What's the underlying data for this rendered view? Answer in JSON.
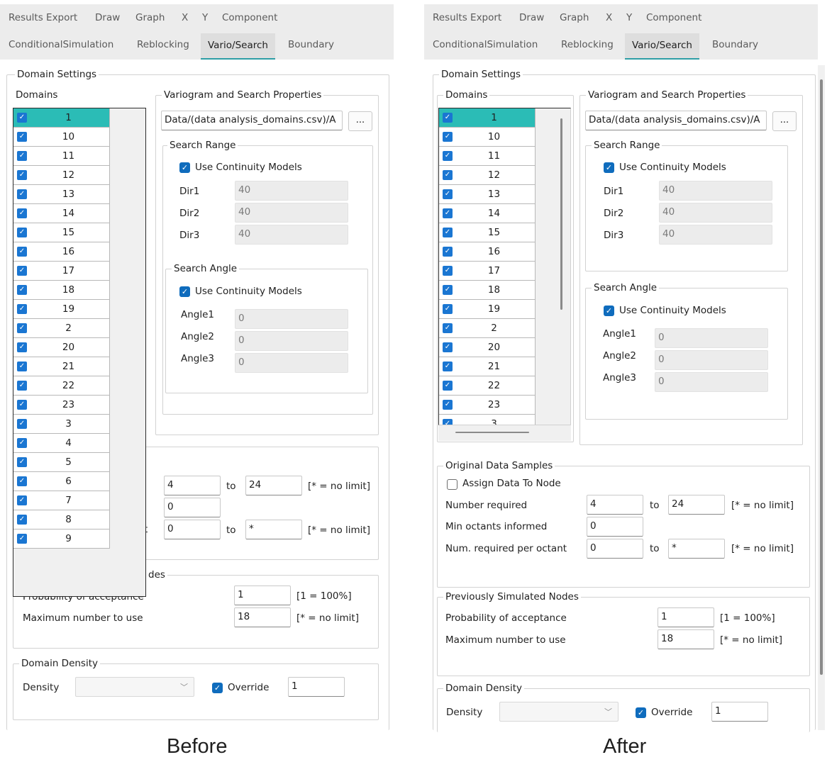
{
  "tabs_row1": [
    "Results Export",
    "Draw",
    "Graph",
    "X",
    "Y",
    "Component"
  ],
  "tabs_row2": [
    "ConditionalSimulation",
    "Reblocking",
    "Vario/Search",
    "Boundary"
  ],
  "domain_settings": {
    "title": "Domain Settings",
    "domains_label": "Domains",
    "domains": [
      "1",
      "10",
      "11",
      "12",
      "13",
      "14",
      "15",
      "16",
      "17",
      "18",
      "19",
      "2",
      "20",
      "21",
      "22",
      "23",
      "3",
      "4",
      "5",
      "6",
      "7",
      "8",
      "9"
    ],
    "selected_domain": "1"
  },
  "vario": {
    "title": "Variogram and Search Properties",
    "file_path": "Data/(data analysis_domains.csv)/A",
    "browse_label": "...",
    "search_range": {
      "title": "Search Range",
      "use_continuity": "Use Continuity Models",
      "labels": [
        "Dir1",
        "Dir2",
        "Dir3"
      ],
      "values": [
        "40",
        "40",
        "40"
      ]
    },
    "search_angle": {
      "title": "Search Angle",
      "use_continuity": "Use Continuity Models",
      "labels": [
        "Angle1",
        "Angle2",
        "Angle3"
      ],
      "values": [
        "0",
        "0",
        "0"
      ]
    }
  },
  "original_samples": {
    "title": "Original Data Samples",
    "assign_label": "Assign Data To Node",
    "number_required_label": "Number required",
    "number_required_from": "4",
    "number_required_to": "24",
    "min_octants_label": "Min octants informed",
    "min_octants": "0",
    "per_octant_label": "Num. required per octant",
    "per_octant_from": "0",
    "per_octant_to": "*",
    "to_label": "to",
    "no_limit": "[* = no limit]"
  },
  "previous_nodes": {
    "title": "Previously Simulated Nodes",
    "before_title_fragment": "des",
    "prob_label": "Probability of acceptance",
    "prob_value": "1",
    "prob_hint": "[1 = 100%]",
    "max_label": "Maximum number to use",
    "max_value": "18",
    "max_hint": "[* = no limit]"
  },
  "density": {
    "title": "Domain Density",
    "density_label": "Density",
    "override_label": "Override",
    "override_value": "1"
  },
  "captions": {
    "before": "Before",
    "after": "After"
  }
}
